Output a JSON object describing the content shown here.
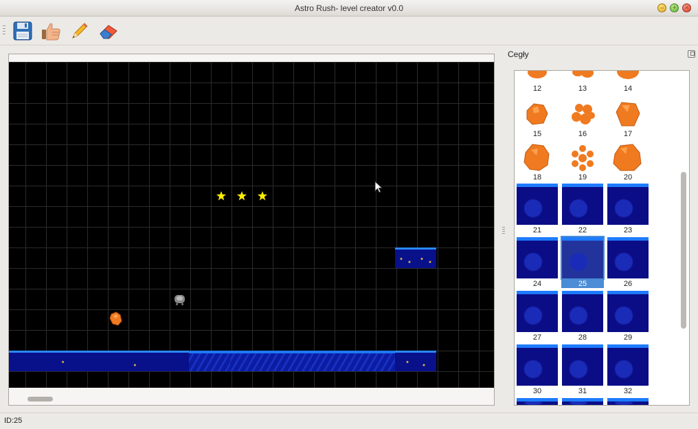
{
  "window": {
    "title": "Astro Rush- level creator v0.0"
  },
  "toolbar": {
    "tools": [
      {
        "name": "save",
        "icon": "floppy-disk-icon"
      },
      {
        "name": "approve",
        "icon": "thumbs-up-icon"
      },
      {
        "name": "draw",
        "icon": "pencil-icon"
      },
      {
        "name": "erase",
        "icon": "eraser-icon"
      }
    ]
  },
  "dock": {
    "title": "Cegły",
    "selected_id": "25",
    "tiles_top_partial": [
      "12",
      "13",
      "14"
    ],
    "rocks_row_1": [
      "15",
      "16",
      "17"
    ],
    "rocks_row_2": [
      "18",
      "19",
      "20"
    ],
    "water_row_1": [
      "21",
      "22",
      "23"
    ],
    "water_row_2": [
      "24",
      "25",
      "26"
    ],
    "water_row_3": [
      "27",
      "28",
      "29"
    ],
    "water_row_4": [
      "30",
      "31",
      "32"
    ]
  },
  "status": {
    "text": "ID:25"
  },
  "colors": {
    "canvas_bg": "#000000",
    "selection": "#4a8cd6",
    "water_top": "#1d78f5",
    "water_body": "#0b1790",
    "rock": "#f07a20",
    "star": "#ffee00"
  }
}
